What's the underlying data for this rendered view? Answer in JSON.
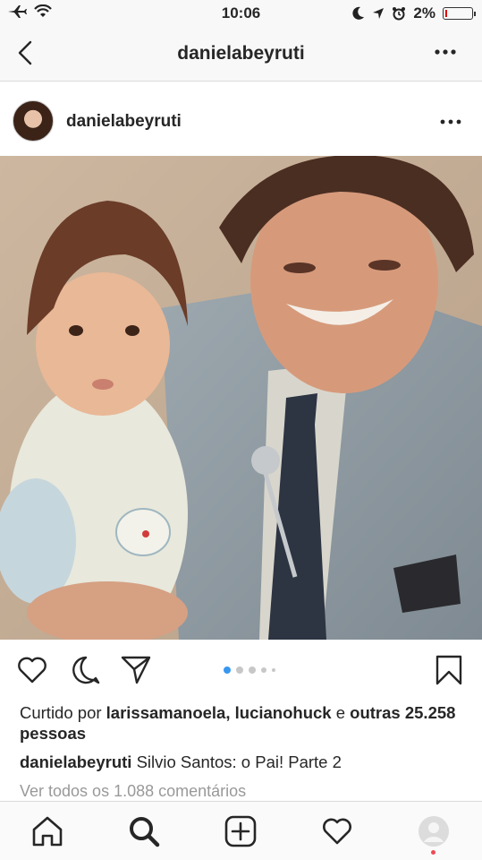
{
  "status_bar": {
    "time": "10:06",
    "battery": "2%"
  },
  "nav": {
    "title": "danielabeyruti"
  },
  "post": {
    "username": "danielabeyruti",
    "carousel": {
      "count": 5,
      "active_index": 0
    },
    "likes": {
      "prefix": "Curtido por",
      "user1": "larissamanoela",
      "separator": ",",
      "user2": "lucianohuck",
      "conj": "e",
      "others": "outras 25.258 pessoas"
    },
    "caption": {
      "username": "danielabeyruti",
      "text": "Silvio Santos: o Pai! Parte 2"
    },
    "view_comments": "Ver todos os 1.088 comentários"
  },
  "icons": {
    "back": "chevron-left-icon",
    "more": "more-horizontal-icon",
    "like": "heart-icon",
    "comment": "comment-icon",
    "share": "paper-plane-icon",
    "save": "bookmark-icon",
    "home": "home-icon",
    "search": "search-icon",
    "new_post": "plus-square-icon",
    "activity": "heart-icon",
    "profile": "profile-icon"
  },
  "colors": {
    "accent": "#3897f0",
    "notification": "#ed4956",
    "text": "#262626",
    "muted": "#999999"
  }
}
